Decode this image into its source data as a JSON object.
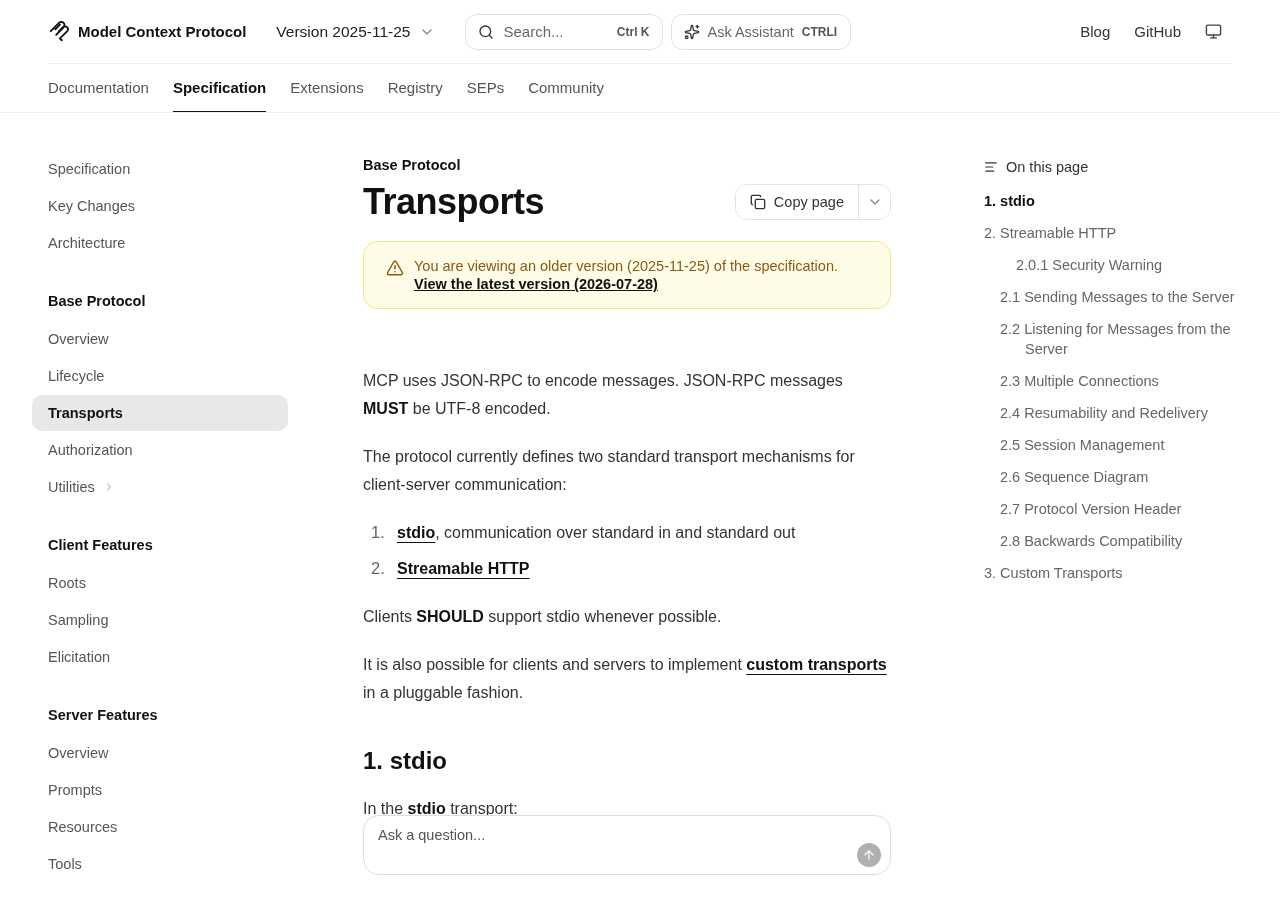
{
  "header": {
    "logo": "Model Context Protocol",
    "version": "Version 2025-11-25",
    "search": {
      "placeholder": "Search...",
      "shortcut": "Ctrl K"
    },
    "assistant": {
      "label": "Ask Assistant",
      "shortcut": "CTRLI"
    },
    "links": [
      "Blog",
      "GitHub"
    ]
  },
  "nav_tabs": [
    {
      "label": "Documentation",
      "selected": false
    },
    {
      "label": "Specification",
      "selected": true
    },
    {
      "label": "Extensions",
      "selected": false
    },
    {
      "label": "Registry",
      "selected": false
    },
    {
      "label": "SEPs",
      "selected": false
    },
    {
      "label": "Community",
      "selected": false
    }
  ],
  "sidebar": {
    "groups": [
      {
        "items": [
          {
            "label": "Specification",
            "kind": "page",
            "selected": false
          },
          {
            "label": "Key Changes",
            "kind": "page",
            "selected": false
          },
          {
            "label": "Architecture",
            "kind": "page",
            "selected": false
          }
        ]
      },
      {
        "title": "Base Protocol",
        "items": [
          {
            "label": "Overview",
            "kind": "page",
            "selected": false
          },
          {
            "label": "Lifecycle",
            "kind": "page",
            "selected": false
          },
          {
            "label": "Transports",
            "kind": "page",
            "selected": true
          },
          {
            "label": "Authorization",
            "kind": "page",
            "selected": false
          },
          {
            "label": "Utilities",
            "kind": "folder",
            "selected": false
          }
        ]
      },
      {
        "title": "Client Features",
        "items": [
          {
            "label": "Roots",
            "kind": "page",
            "selected": false
          },
          {
            "label": "Sampling",
            "kind": "page",
            "selected": false
          },
          {
            "label": "Elicitation",
            "kind": "page",
            "selected": false
          }
        ]
      },
      {
        "title": "Server Features",
        "items": [
          {
            "label": "Overview",
            "kind": "page",
            "selected": false
          },
          {
            "label": "Prompts",
            "kind": "page",
            "selected": false
          },
          {
            "label": "Resources",
            "kind": "page",
            "selected": false
          },
          {
            "label": "Tools",
            "kind": "page",
            "selected": false
          }
        ]
      }
    ]
  },
  "article": {
    "eyebrow": "Base Protocol",
    "title": "Transports",
    "copy_button": "Copy page",
    "notice": {
      "text": "You are viewing an older version (2025-11-25) of the specification.",
      "link": "View the latest version (2026-07-28)"
    },
    "blocks": [
      {
        "kind": "paragraph",
        "parts": [
          {
            "kind": "text",
            "text": "MCP uses JSON-RPC to encode messages. JSON-RPC messages **MUST** be UTF-8 encoded."
          }
        ]
      },
      {
        "kind": "paragraph",
        "parts": [
          {
            "kind": "text",
            "text": "The protocol currently defines two standard transport mechanisms for client-server communication:"
          }
        ]
      },
      {
        "kind": "list",
        "items": [
          {
            "number": "1.",
            "parts": [
              {
                "kind": "link",
                "text": "stdio"
              },
              {
                "kind": "text",
                "text": ", communication over standard in and standard out"
              }
            ]
          },
          {
            "number": "2.",
            "parts": [
              {
                "kind": "link",
                "text": "Streamable HTTP"
              }
            ]
          }
        ]
      },
      {
        "kind": "paragraph",
        "parts": [
          {
            "kind": "text",
            "text": "Clients **SHOULD** support stdio whenever possible."
          }
        ]
      },
      {
        "kind": "paragraph",
        "parts": [
          {
            "kind": "text",
            "text": "It is also possible for clients and servers to implement "
          },
          {
            "kind": "link",
            "text": "custom transports"
          },
          {
            "kind": "text",
            "text": " in a pluggable fashion."
          }
        ]
      },
      {
        "kind": "heading",
        "parts": [
          {
            "kind": "text",
            "text": "1. stdio"
          }
        ]
      },
      {
        "kind": "paragraph",
        "parts": [
          {
            "kind": "text",
            "text": "In the **stdio** transport:"
          }
        ]
      }
    ]
  },
  "ask_box": {
    "placeholder": "Ask a question..."
  },
  "toc": {
    "title": "On this page",
    "items": [
      {
        "label": "1. stdio",
        "selected": true
      },
      {
        "label": "2. Streamable HTTP",
        "selected": false,
        "children": [
          {
            "label": "2.0.1 Security Warning",
            "selected": false,
            "kind": "deep"
          },
          {
            "label": "2.1 Sending Messages to the Server",
            "selected": false,
            "kind": "normal"
          },
          {
            "label": "2.2 Listening for Messages from the Server",
            "selected": false,
            "kind": "normal"
          },
          {
            "label": "2.3 Multiple Connections",
            "selected": false,
            "kind": "normal"
          },
          {
            "label": "2.4 Resumability and Redelivery",
            "selected": false,
            "kind": "normal"
          },
          {
            "label": "2.5 Session Management",
            "selected": false,
            "kind": "normal"
          },
          {
            "label": "2.6 Sequence Diagram",
            "selected": false,
            "kind": "normal"
          },
          {
            "label": "2.7 Protocol Version Header",
            "selected": false,
            "kind": "normal"
          },
          {
            "label": "2.8 Backwards Compatibility",
            "selected": false,
            "kind": "normal"
          }
        ]
      },
      {
        "label": "3. Custom Transports",
        "selected": false
      }
    ]
  }
}
